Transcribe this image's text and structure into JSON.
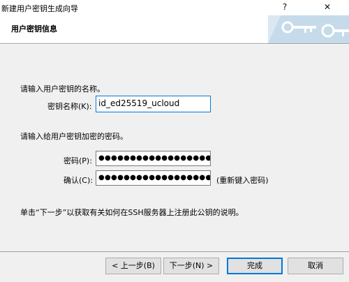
{
  "window": {
    "title": "新建用户密钥生成向导",
    "help_glyph": "?",
    "close_glyph": "✕"
  },
  "header": {
    "title": "用户密钥信息"
  },
  "name_section": {
    "prompt": "请输入用户密钥的名称。",
    "label": "密钥名称(K):",
    "value": "id_ed25519_ucloud"
  },
  "password_section": {
    "prompt": "请输入给用户密钥加密的密码。",
    "password_label": "密码(P):",
    "password_value": "●●●●●●●●●●●●●●●●●●●●●●●●●●",
    "confirm_label": "确认(C):",
    "confirm_value": "●●●●●●●●●●●●●●●●●●●●●●●●●●",
    "retype_hint": "(重新键入密码)"
  },
  "info_text": "单击“下一步”以获取有关如何在SSH服务器上注册此公钥的说明。",
  "buttons": {
    "back": "< 上一步(B)",
    "next": "下一步(N) >",
    "finish": "完成",
    "cancel": "取消"
  },
  "colors": {
    "accent": "#0078d7",
    "header_art": "#bcd4e6"
  }
}
